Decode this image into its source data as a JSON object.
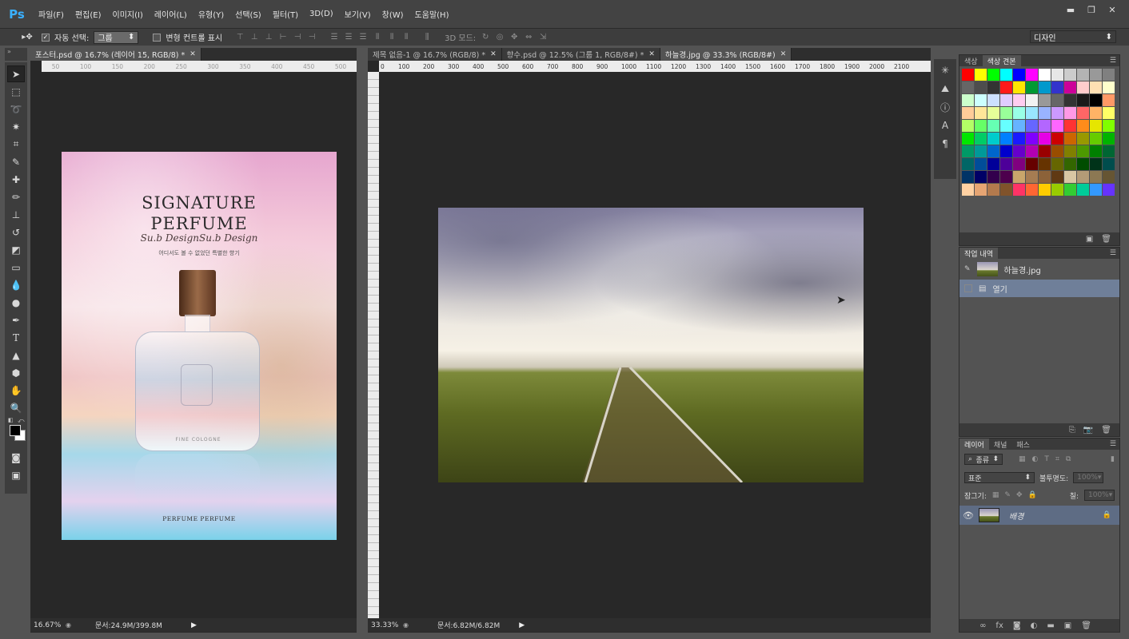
{
  "app": {
    "logo": "Ps"
  },
  "menu": [
    "파일(F)",
    "편집(E)",
    "이미지(I)",
    "레이어(L)",
    "유형(Y)",
    "선택(S)",
    "필터(T)",
    "3D(D)",
    "보기(V)",
    "창(W)",
    "도움말(H)"
  ],
  "window_controls": {
    "minimize": "▬",
    "maximize": "❐",
    "close": "✕"
  },
  "options": {
    "auto_select_checked": true,
    "auto_select_label": "자동 선택:",
    "auto_select_target": "그룹",
    "show_transform_label": "변형 컨트롤 표시",
    "mode_3d_label": "3D 모드:",
    "workspace": "디자인"
  },
  "tools": [
    "move-icon",
    "marquee-icon",
    "lasso-icon",
    "magic-wand-icon",
    "crop-icon",
    "eyedropper-icon",
    "healing-icon",
    "brush-icon",
    "stamp-icon",
    "history-brush-icon",
    "eraser-icon",
    "gradient-icon",
    "blur-icon",
    "dodge-icon",
    "pen-icon",
    "type-icon",
    "path-select-icon",
    "shape-icon",
    "hand-icon",
    "zoom-icon"
  ],
  "left_doc": {
    "tab": "포스터.psd @ 16.7% (레이어 15, RGB/8) *",
    "ruler_ticks": [
      "50",
      "100",
      "150",
      "200",
      "250",
      "300",
      "350",
      "400",
      "450",
      "500"
    ],
    "zoom": "16.67%",
    "doc_size": "문서:24.9M/399.8M",
    "poster": {
      "title_line1": "SIGNATURE",
      "title_line2": "PERFUME",
      "script": "Su.b DesignSu.b Design",
      "tagline": "어디서도 볼 수 없었던 특별한 향기",
      "bottle_label": "FINE COLOGNE",
      "footer": "PERFUME PERFUME"
    }
  },
  "right_doc": {
    "tabs": [
      {
        "label": "제목 없음-1 @ 16.7% (RGB/8) *",
        "active": false
      },
      {
        "label": "향수.psd @ 12.5% (그룹 1, RGB/8#) *",
        "active": false
      },
      {
        "label": "하늘경.jpg @ 33.3% (RGB/8#)",
        "active": true
      }
    ],
    "ruler_ticks": [
      "0",
      "100",
      "200",
      "300",
      "400",
      "500",
      "600",
      "700",
      "800",
      "900",
      "1000",
      "1100",
      "1200",
      "1300",
      "1400",
      "1500",
      "1600",
      "1700",
      "1800",
      "1900",
      "2000",
      "2100"
    ],
    "zoom": "33.33%",
    "doc_size": "문서:6.82M/6.82M"
  },
  "color_panel": {
    "tabs": [
      "색상",
      "색상 견본"
    ],
    "swatches": [
      "#ff0000",
      "#ffff00",
      "#00ff00",
      "#00ffff",
      "#0000ff",
      "#ff00ff",
      "#ffffff",
      "#e6e6e6",
      "#cccccc",
      "#b3b3b3",
      "#999999",
      "#808080",
      "#666666",
      "#4d4d4d",
      "#333333",
      "#ff1a1a",
      "#ffe600",
      "#009933",
      "#0099cc",
      "#3333cc",
      "#cc0099",
      "#ffcccc",
      "#ffe0b3",
      "#ffffcc",
      "#ccffcc",
      "#ccffff",
      "#cce0ff",
      "#e0ccff",
      "#ffccf0",
      "#f2f2f2",
      "#999999",
      "#666666",
      "#333333",
      "#1a1a1a",
      "#000000",
      "#ff9966",
      "#ffcc99",
      "#ffe699",
      "#e6ff99",
      "#99ff99",
      "#99ffe6",
      "#99e6ff",
      "#99b3ff",
      "#cc99ff",
      "#ff99e6",
      "#ff6666",
      "#ffb366",
      "#ffff66",
      "#b3ff66",
      "#66ff66",
      "#66ffb3",
      "#66ffff",
      "#66b3ff",
      "#6666ff",
      "#b366ff",
      "#ff66ff",
      "#ff3333",
      "#ff8c1a",
      "#e6e600",
      "#80ff00",
      "#00e600",
      "#00cc66",
      "#00cccc",
      "#0080ff",
      "#1a1aff",
      "#8000ff",
      "#e600e6",
      "#cc0000",
      "#cc6600",
      "#999900",
      "#66cc00",
      "#00b300",
      "#009966",
      "#009999",
      "#0066cc",
      "#0000cc",
      "#6600cc",
      "#b300b3",
      "#990000",
      "#994d00",
      "#808000",
      "#4d9900",
      "#008000",
      "#006633",
      "#006666",
      "#004d99",
      "#000099",
      "#4d0099",
      "#800080",
      "#660000",
      "#663300",
      "#666600",
      "#336600",
      "#004d00",
      "#003319",
      "#004d4d",
      "#003366",
      "#000066",
      "#33004d",
      "#4d004d",
      "#c9a66b",
      "#a67c52",
      "#8c6239",
      "#603913",
      "#d9c7a3",
      "#b39b77",
      "#8c7853",
      "#665533",
      "#ffd1a3",
      "#e6a573",
      "#b37a4d",
      "#80532b",
      "#ff3366",
      "#ff6633",
      "#ffcc00",
      "#99cc00",
      "#33cc33",
      "#00cc99",
      "#3399ff",
      "#6633ff"
    ]
  },
  "history_panel": {
    "title": "작업 내역",
    "snapshot": "하늘경.jpg",
    "items": [
      "열기"
    ]
  },
  "layers_panel": {
    "tabs": [
      "레이어",
      "채널",
      "패스"
    ],
    "filter": "종류",
    "blend_mode": "표준",
    "opacity_label": "불투명도:",
    "opacity": "100%",
    "lock_label": "잠그기:",
    "fill_label": "칠:",
    "fill": "100%",
    "layers": [
      {
        "name": "배경",
        "visible": true,
        "locked": true
      }
    ]
  }
}
